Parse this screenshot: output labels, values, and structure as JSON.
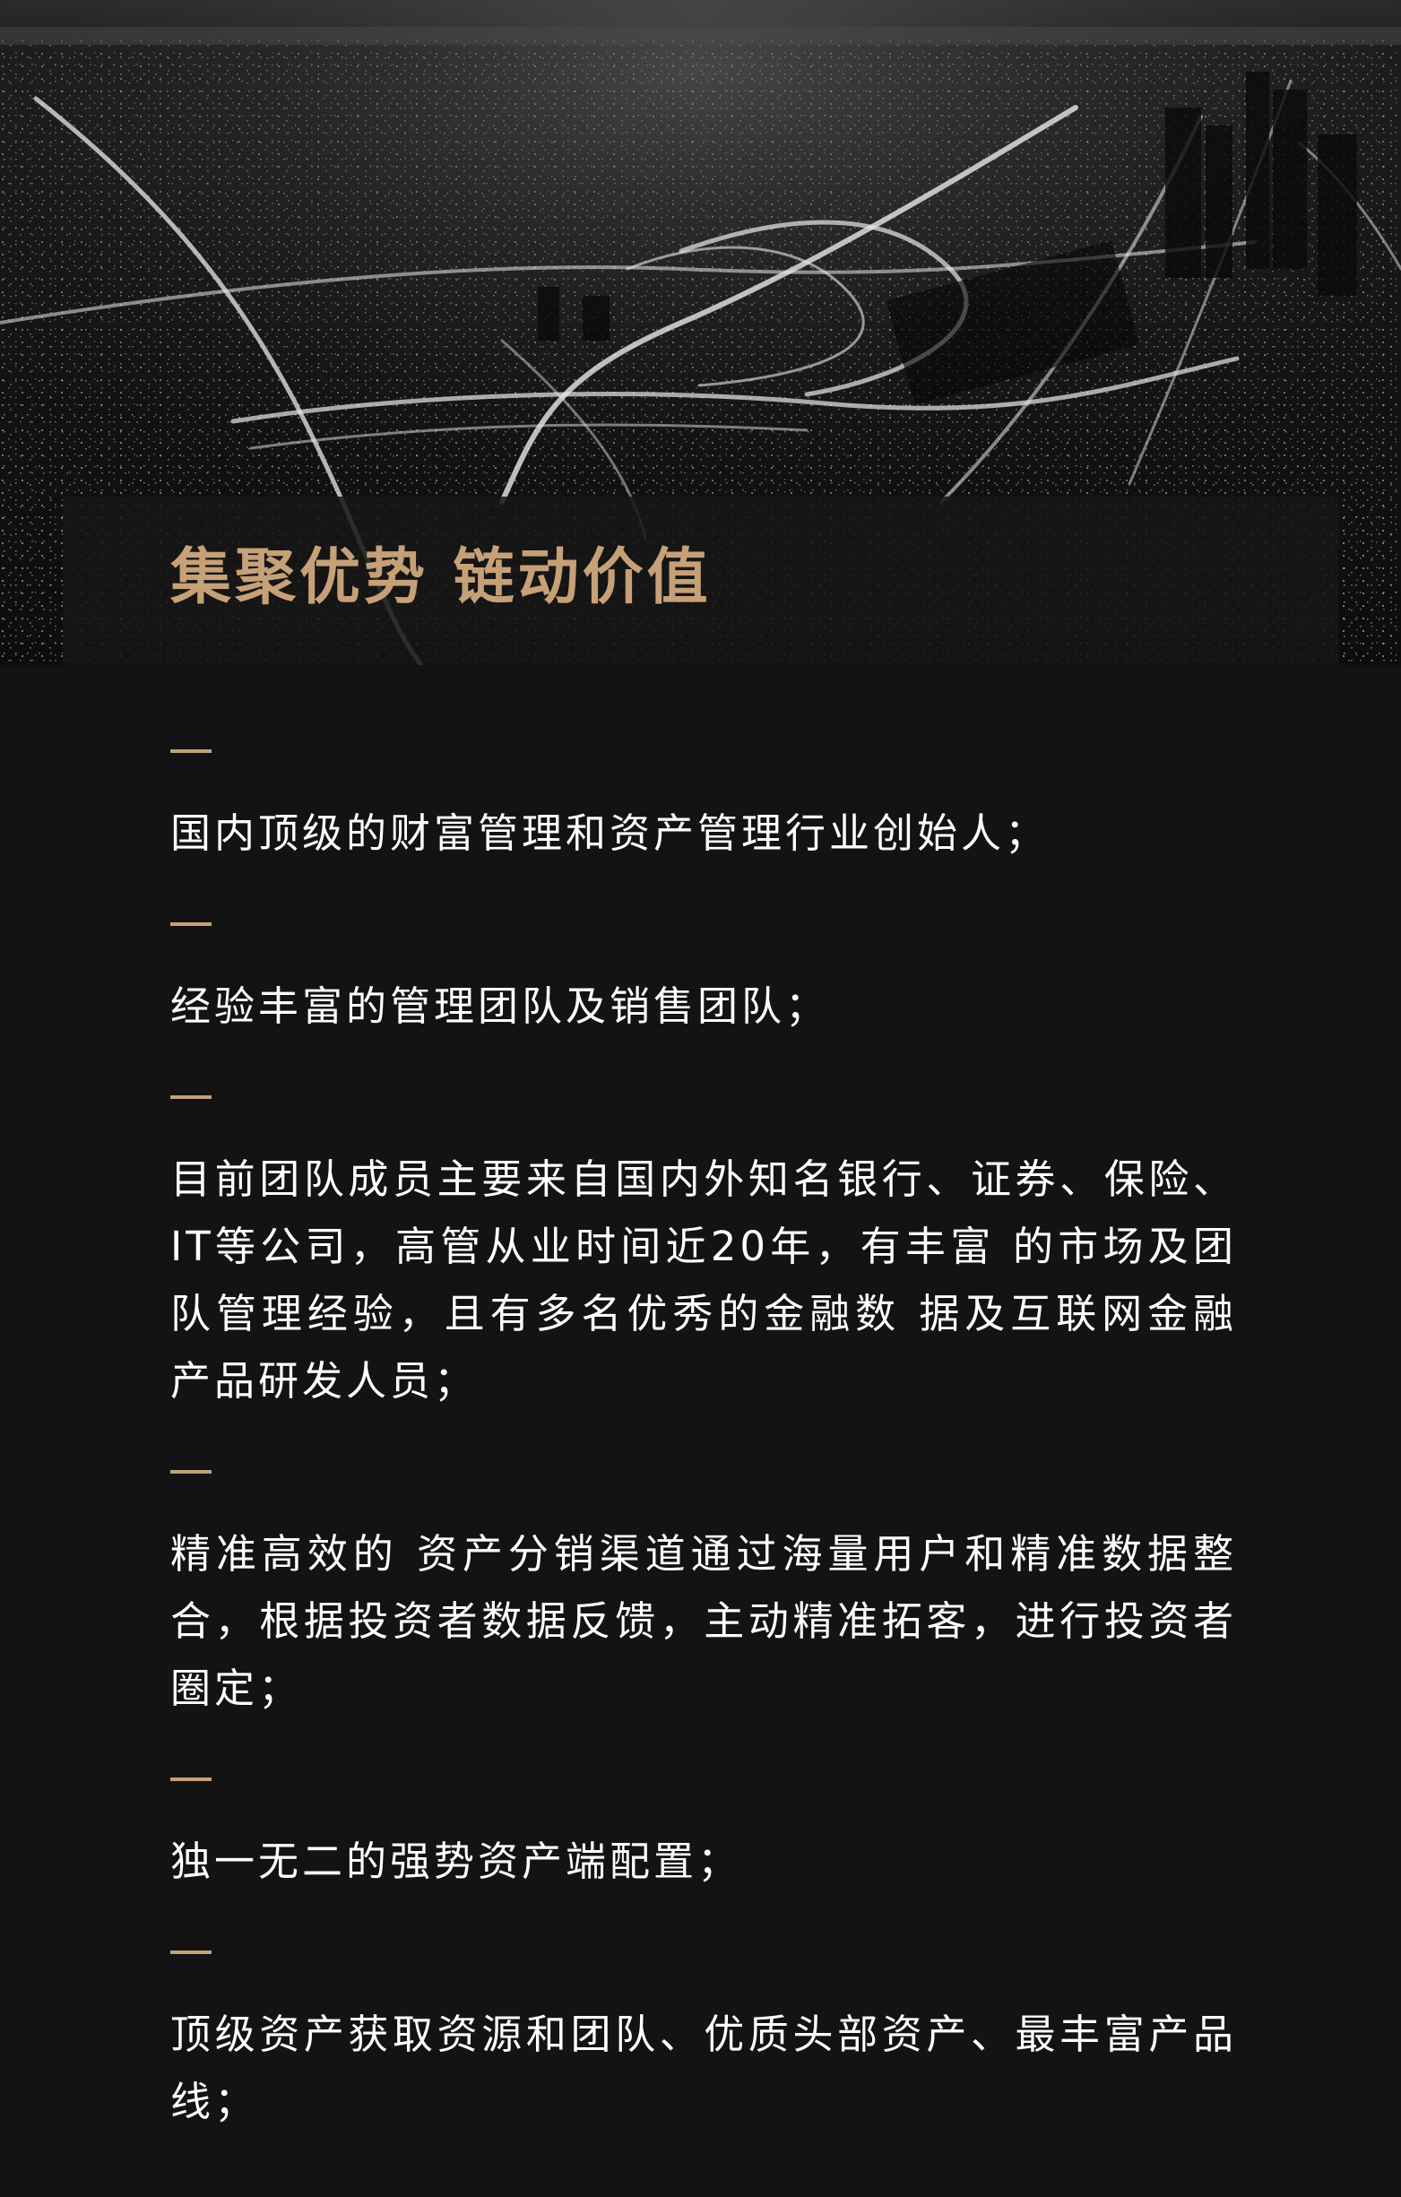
{
  "colors": {
    "background": "#131313",
    "accent_gold": "#c6a077",
    "body_text": "#ffffff"
  },
  "hero": {
    "image": "night-city-highway-photo"
  },
  "header": {
    "title": "集聚优势  链动价值"
  },
  "items": [
    {
      "text": "国内顶级的财富管理和资产管理行业创始人；"
    },
    {
      "text": "经验丰富的管理团队及销售团队；"
    },
    {
      "text": "目前团队成员主要来自国内外知名银行、证券、保险、IT等公司，高管从业时间近20年，有丰富 的市场及团队管理经验，且有多名优秀的金融数 据及互联网金融产品研发人员；"
    },
    {
      "text": "精准高效的 资产分销渠道通过海量用户和精准数据整合，根据投资者数据反馈，主动精准拓客，进行投资者圈定；"
    },
    {
      "text": "独一无二的强势资产端配置；"
    },
    {
      "text": "顶级资产获取资源和团队、优质头部资产、最丰富产品线；"
    }
  ]
}
